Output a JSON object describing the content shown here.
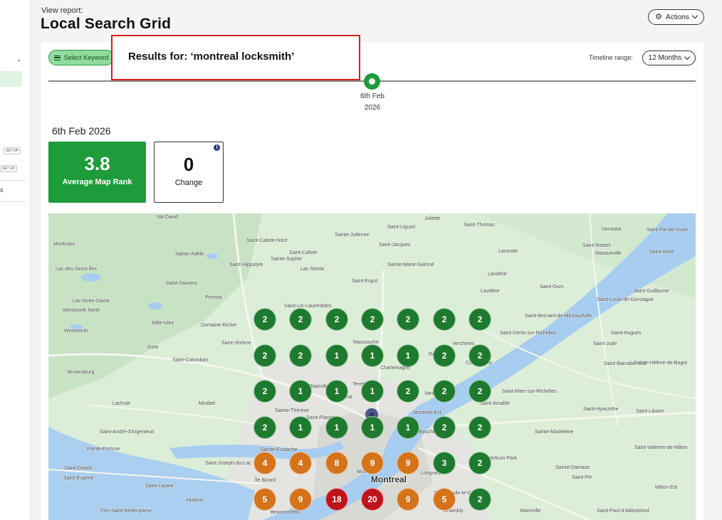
{
  "header": {
    "view_report": "View report:",
    "title": "Local Search Grid",
    "actions_label": "Actions"
  },
  "toolbar": {
    "select_keyword_label": "Select Keyword",
    "results_text": "Results for: ‘montreal locksmith’",
    "timeline_label": "Timeline range:",
    "timeline_value": "12 Months"
  },
  "timeline": {
    "point_line1": "6th Feb",
    "point_line2": "2026"
  },
  "summary": {
    "date_heading": "6th Feb 2026",
    "average_rank_value": "3.8",
    "average_rank_label": "Average Map Rank",
    "change_value": "0",
    "change_label": "Change",
    "info_glyph": "i"
  },
  "sidebar": {
    "badge1": "SET UP",
    "badge2": "SET UP",
    "truncated_item": "s"
  },
  "colors": {
    "rank_good": "#1e7a2e",
    "rank_mid": "#d4731a",
    "rank_bad": "#c0141c",
    "accent_green": "#1e9b3a"
  },
  "grid": {
    "rows": [
      [
        2,
        2,
        2,
        2,
        2,
        2,
        2
      ],
      [
        2,
        2,
        1,
        1,
        1,
        2,
        2
      ],
      [
        2,
        1,
        1,
        1,
        2,
        2,
        2
      ],
      [
        2,
        1,
        1,
        1,
        1,
        2,
        2
      ],
      [
        4,
        4,
        8,
        9,
        9,
        3,
        2
      ],
      [
        5,
        9,
        18,
        20,
        9,
        5,
        2
      ]
    ]
  },
  "map_labels": [
    "Val-David",
    "Sainte-Julienne",
    "Saint-Liguori",
    "Joliette",
    "Saint-Thomas",
    "Yamaska",
    "Saint-Pie-de-Guire",
    "Montcalm",
    "Sainte-Adèle",
    "Saint-Calixte-Nord",
    "Saint-Calixte",
    "Saint-Jacques",
    "Sainte-Marie-Salomé",
    "Lanoraie",
    "Saint-Robert",
    "Saint-Aimé",
    "Lac-des-Seize-Îles",
    "Saint-Hippolyte",
    "Sainte-Sophie",
    "Lac-Siesta",
    "Saint-Esprit",
    "Lavaltrie",
    "Massueville",
    "Lac-Notre-Dame",
    "Saint-Sauveur",
    "Prevost",
    "Saint-Lin-Laurentides",
    "Saint-Ours",
    "Saint-Louis-de-Gonzague",
    "Saint-Guillaume",
    "Wentworth North",
    "Mille-Isles",
    "Domaine-Richer",
    "Saint-Bernard-de-Michaudville",
    "Saint-Denis-sur-Richelieu",
    "Saint-Hugues",
    "Wentworth",
    "Mascouche",
    "Saint-Jérôme",
    "Repentigny",
    "Verchères",
    "Saint-Jude",
    "Gore",
    "Saint-Colomban",
    "Charlemagne",
    "Contrecœur",
    "Saint-Barnabé-Sud",
    "Brownsburg",
    "Terrebonne",
    "Varennes",
    "Saint-Marc-sur-Richelieu",
    "Sainte-Hélène-de-Bagot",
    "Lachute",
    "Mirabel",
    "Sainte-Thérèse",
    "Blainville",
    "Laval",
    "Montréal-Est",
    "Saint-Amable",
    "Saint-Hyacinthe",
    "Saint-Liboire",
    "Saint-André-d'Argenteuil",
    "Boucherville",
    "Sainte-Madeleine",
    "Saint-Valérien-de-Milton",
    "Pointe-Fortune",
    "Sainte-Eustache",
    "Otterburn Park",
    "Sainte-Damase",
    "Saint-Joseph-du-Lac",
    "Longueuil",
    "Saint-Pie",
    "Saint-Placide",
    "Montréal",
    "Montreal",
    "Île Bizard",
    "Saint-Basile-le-Grand",
    "Milton-Est",
    "Saint-Lazare",
    "Hudson",
    "Beaconsfield",
    "Chambly",
    "Marieville",
    "Saint-Paul-d'Abbotsford",
    "Très-Saint-Rédempteur",
    "Saint-Éugène",
    "Saint-Davids",
    "Lavaltrie"
  ]
}
